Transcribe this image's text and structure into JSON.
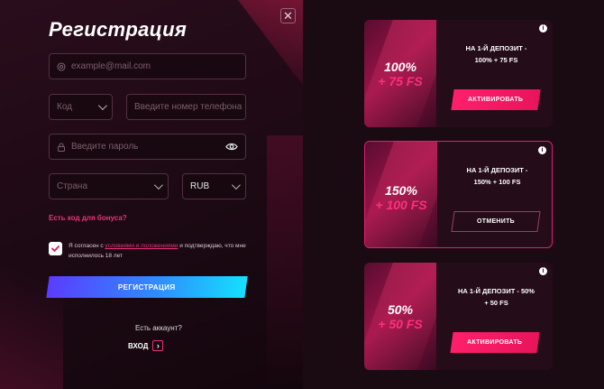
{
  "registration": {
    "title": "Регистрация",
    "email_placeholder": "example@mail.com",
    "code_label": "Код",
    "phone_placeholder": "Введите номер телефона",
    "password_placeholder": "Введите пароль",
    "country_label": "Страна",
    "currency_value": "RUB",
    "bonus_code_link": "Есть код для бонуса?",
    "agree_prefix": "Я согласен с ",
    "agree_link": "условиями и положениями",
    "agree_suffix": " и подтверждаю, что мне исполнилось 18 лет",
    "agree_checked": true,
    "register_button": "РЕГИСТРАЦИЯ",
    "have_account": "Есть аккаунт?",
    "login_label": "ВХОД"
  },
  "close_icon": "close-icon",
  "offers": [
    {
      "percent": "100%",
      "fs": "+ 75 FS",
      "desc_line1": "НА 1-Й ДЕПОЗИТ -",
      "desc_line2": "100% + 75 FS",
      "button": "АКТИВИРОВАТЬ",
      "state": "inactive"
    },
    {
      "percent": "150%",
      "fs": "+ 100 FS",
      "desc_line1": "НА 1-Й ДЕПОЗИТ -",
      "desc_line2": "150% + 100 FS",
      "button": "ОТМЕНИТЬ",
      "state": "active"
    },
    {
      "percent": "50%",
      "fs": "+ 50 FS",
      "desc_line1": "НА 1-Й ДЕПОЗИТ - 50%",
      "desc_line2": "+ 50 FS",
      "button": "АКТИВИРОВАТЬ",
      "state": "inactive"
    }
  ],
  "colors": {
    "accent": "#e8337a",
    "gradient_start": "#5a3cff",
    "gradient_end": "#14e0ff",
    "bg": "#1a0812"
  }
}
